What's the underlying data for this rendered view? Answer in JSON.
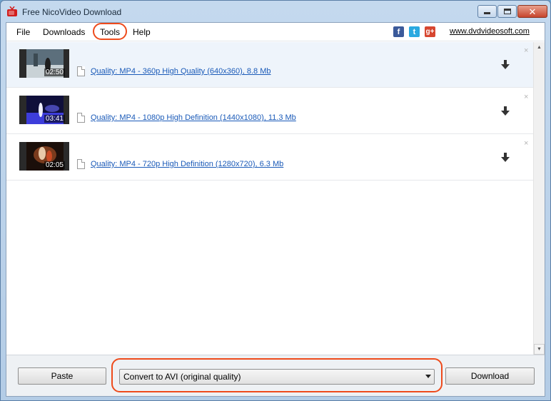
{
  "window": {
    "title": "Free NicoVideo Download",
    "colors": {
      "accent_highlight": "#ee4b1c",
      "link": "#1a5ab8",
      "close_button": "#c7452d"
    }
  },
  "menu": {
    "items": [
      "File",
      "Downloads",
      "Tools",
      "Help"
    ],
    "highlighted": "Tools"
  },
  "social": {
    "facebook": "f",
    "twitter": "t",
    "googleplus": "g+"
  },
  "site_link": "www.dvdvideosoft.com",
  "downloads": [
    {
      "duration": "02:50",
      "quality": "Quality: MP4 - 360p High Quality (640x360), 8.8 Mb",
      "selected": true
    },
    {
      "duration": "03:41",
      "quality": "Quality: MP4 - 1080p High Definition (1440x1080), 11.3 Mb",
      "selected": false
    },
    {
      "duration": "02:05",
      "quality": "Quality: MP4 - 720p High Definition (1280x720), 6.3 Mb",
      "selected": false
    }
  ],
  "item_close_glyph": "×",
  "bottom": {
    "paste_label": "Paste",
    "convert_selected": "Convert to AVI (original quality)",
    "download_label": "Download"
  },
  "icons": {
    "app": "tv-icon",
    "download": "down-arrow-icon",
    "file": "file-icon"
  }
}
